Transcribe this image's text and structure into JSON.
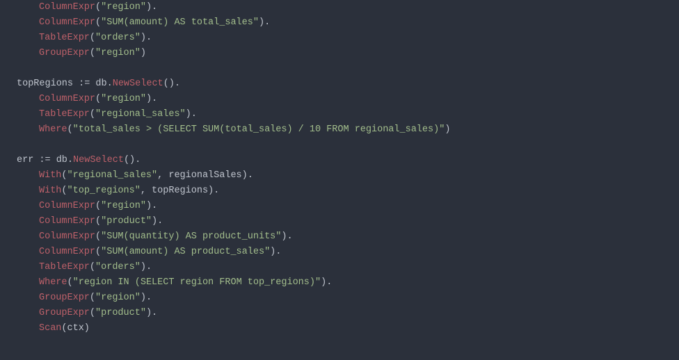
{
  "code": {
    "lines": [
      {
        "indent": 1,
        "parts": [
          {
            "t": "method",
            "v": "ColumnExpr"
          },
          {
            "t": "punc",
            "v": "("
          },
          {
            "t": "str",
            "v": "\"region\""
          },
          {
            "t": "punc",
            "v": ")."
          }
        ]
      },
      {
        "indent": 1,
        "parts": [
          {
            "t": "method",
            "v": "ColumnExpr"
          },
          {
            "t": "punc",
            "v": "("
          },
          {
            "t": "str",
            "v": "\"SUM(amount) AS total_sales\""
          },
          {
            "t": "punc",
            "v": ")."
          }
        ]
      },
      {
        "indent": 1,
        "parts": [
          {
            "t": "method",
            "v": "TableExpr"
          },
          {
            "t": "punc",
            "v": "("
          },
          {
            "t": "str",
            "v": "\"orders\""
          },
          {
            "t": "punc",
            "v": ")."
          }
        ]
      },
      {
        "indent": 1,
        "parts": [
          {
            "t": "method",
            "v": "GroupExpr"
          },
          {
            "t": "punc",
            "v": "("
          },
          {
            "t": "str",
            "v": "\"region\""
          },
          {
            "t": "punc",
            "v": ")"
          }
        ]
      },
      {
        "indent": 0,
        "parts": []
      },
      {
        "indent": 0,
        "parts": [
          {
            "t": "ident",
            "v": "topRegions "
          },
          {
            "t": "op",
            "v": ":="
          },
          {
            "t": "ident",
            "v": " db."
          },
          {
            "t": "method",
            "v": "NewSelect"
          },
          {
            "t": "punc",
            "v": "()."
          }
        ]
      },
      {
        "indent": 1,
        "parts": [
          {
            "t": "method",
            "v": "ColumnExpr"
          },
          {
            "t": "punc",
            "v": "("
          },
          {
            "t": "str",
            "v": "\"region\""
          },
          {
            "t": "punc",
            "v": ")."
          }
        ]
      },
      {
        "indent": 1,
        "parts": [
          {
            "t": "method",
            "v": "TableExpr"
          },
          {
            "t": "punc",
            "v": "("
          },
          {
            "t": "str",
            "v": "\"regional_sales\""
          },
          {
            "t": "punc",
            "v": ")."
          }
        ]
      },
      {
        "indent": 1,
        "parts": [
          {
            "t": "method",
            "v": "Where"
          },
          {
            "t": "punc",
            "v": "("
          },
          {
            "t": "str",
            "v": "\"total_sales > (SELECT SUM(total_sales) / 10 FROM regional_sales)\""
          },
          {
            "t": "punc",
            "v": ")"
          }
        ]
      },
      {
        "indent": 0,
        "parts": []
      },
      {
        "indent": 0,
        "parts": [
          {
            "t": "ident",
            "v": "err "
          },
          {
            "t": "op",
            "v": ":="
          },
          {
            "t": "ident",
            "v": " db."
          },
          {
            "t": "method",
            "v": "NewSelect"
          },
          {
            "t": "punc",
            "v": "()."
          }
        ]
      },
      {
        "indent": 1,
        "parts": [
          {
            "t": "method",
            "v": "With"
          },
          {
            "t": "punc",
            "v": "("
          },
          {
            "t": "str",
            "v": "\"regional_sales\""
          },
          {
            "t": "punc",
            "v": ", regionalSales)."
          }
        ]
      },
      {
        "indent": 1,
        "parts": [
          {
            "t": "method",
            "v": "With"
          },
          {
            "t": "punc",
            "v": "("
          },
          {
            "t": "str",
            "v": "\"top_regions\""
          },
          {
            "t": "punc",
            "v": ", topRegions)."
          }
        ]
      },
      {
        "indent": 1,
        "parts": [
          {
            "t": "method",
            "v": "ColumnExpr"
          },
          {
            "t": "punc",
            "v": "("
          },
          {
            "t": "str",
            "v": "\"region\""
          },
          {
            "t": "punc",
            "v": ")."
          }
        ]
      },
      {
        "indent": 1,
        "parts": [
          {
            "t": "method",
            "v": "ColumnExpr"
          },
          {
            "t": "punc",
            "v": "("
          },
          {
            "t": "str",
            "v": "\"product\""
          },
          {
            "t": "punc",
            "v": ")."
          }
        ]
      },
      {
        "indent": 1,
        "parts": [
          {
            "t": "method",
            "v": "ColumnExpr"
          },
          {
            "t": "punc",
            "v": "("
          },
          {
            "t": "str",
            "v": "\"SUM(quantity) AS product_units\""
          },
          {
            "t": "punc",
            "v": ")."
          }
        ]
      },
      {
        "indent": 1,
        "parts": [
          {
            "t": "method",
            "v": "ColumnExpr"
          },
          {
            "t": "punc",
            "v": "("
          },
          {
            "t": "str",
            "v": "\"SUM(amount) AS product_sales\""
          },
          {
            "t": "punc",
            "v": ")."
          }
        ]
      },
      {
        "indent": 1,
        "parts": [
          {
            "t": "method",
            "v": "TableExpr"
          },
          {
            "t": "punc",
            "v": "("
          },
          {
            "t": "str",
            "v": "\"orders\""
          },
          {
            "t": "punc",
            "v": ")."
          }
        ]
      },
      {
        "indent": 1,
        "parts": [
          {
            "t": "method",
            "v": "Where"
          },
          {
            "t": "punc",
            "v": "("
          },
          {
            "t": "str",
            "v": "\"region IN (SELECT region FROM top_regions)\""
          },
          {
            "t": "punc",
            "v": ")."
          }
        ]
      },
      {
        "indent": 1,
        "parts": [
          {
            "t": "method",
            "v": "GroupExpr"
          },
          {
            "t": "punc",
            "v": "("
          },
          {
            "t": "str",
            "v": "\"region\""
          },
          {
            "t": "punc",
            "v": ")."
          }
        ]
      },
      {
        "indent": 1,
        "parts": [
          {
            "t": "method",
            "v": "GroupExpr"
          },
          {
            "t": "punc",
            "v": "("
          },
          {
            "t": "str",
            "v": "\"product\""
          },
          {
            "t": "punc",
            "v": ")."
          }
        ]
      },
      {
        "indent": 1,
        "parts": [
          {
            "t": "method",
            "v": "Scan"
          },
          {
            "t": "punc",
            "v": "(ctx)"
          }
        ]
      }
    ]
  }
}
